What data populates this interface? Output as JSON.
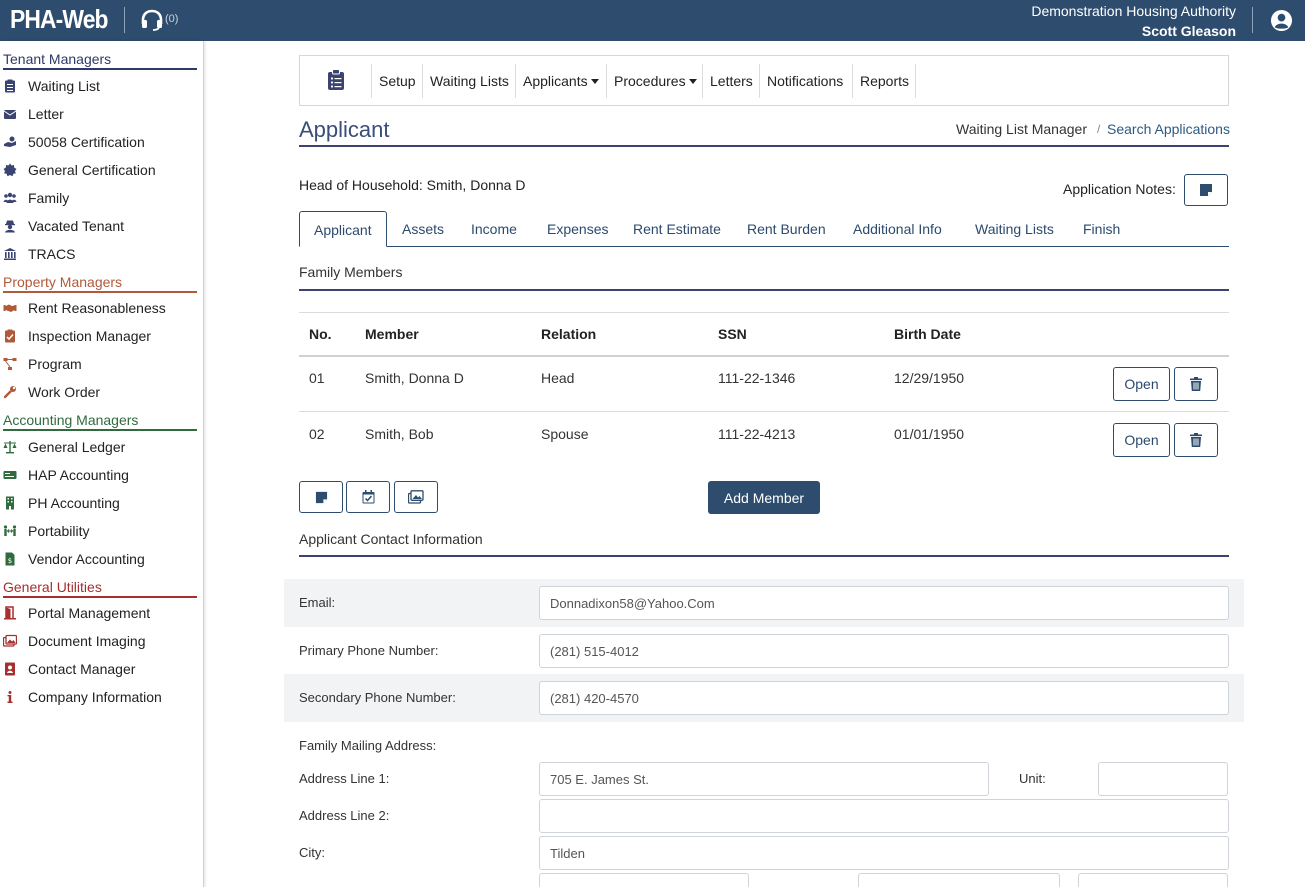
{
  "header": {
    "brand": "PHA-Web",
    "support_count": "(0)",
    "organization": "Demonstration Housing Authority",
    "user": "Scott Gleason"
  },
  "sidebar": {
    "sections": [
      {
        "title": "Tenant Managers",
        "color": "#2e3a66",
        "items": [
          "Waiting List",
          "Letter",
          "50058 Certification",
          "General Certification",
          "Family",
          "Vacated Tenant",
          "TRACS"
        ]
      },
      {
        "title": "Property Managers",
        "color": "#b05a3a",
        "items": [
          "Rent Reasonableness",
          "Inspection Manager",
          "Program",
          "Work Order"
        ]
      },
      {
        "title": "Accounting Managers",
        "color": "#2f6b3d",
        "items": [
          "General Ledger",
          "HAP Accounting",
          "PH Accounting",
          "Portability",
          "Vendor Accounting"
        ]
      },
      {
        "title": "General Utilities",
        "color": "#a62f2f",
        "items": [
          "Portal Management",
          "Document Imaging",
          "Contact Manager",
          "Company Information"
        ]
      }
    ]
  },
  "nav": {
    "items": [
      "Setup",
      "Waiting Lists",
      "Applicants",
      "Procedures",
      "Letters",
      "Notifications",
      "Reports"
    ]
  },
  "page": {
    "title": "Applicant",
    "breadcrumb": [
      "Waiting List Manager",
      "/",
      "Search Applications"
    ],
    "head_of_household": "Head of Household: Smith, Donna D",
    "notes_label": "Application Notes:"
  },
  "tabs": [
    "Applicant",
    "Assets",
    "Income",
    "Expenses",
    "Rent Estimate",
    "Rent Burden",
    "Additional Info",
    "Waiting Lists",
    "Finish"
  ],
  "family": {
    "heading": "Family Members",
    "columns": [
      "No.",
      "Member",
      "Relation",
      "SSN",
      "Birth Date"
    ],
    "rows": [
      {
        "no": "01",
        "member": "Smith, Donna D",
        "relation": "Head",
        "ssn": "111-22-1346",
        "birth": "12/29/1950",
        "open": "Open"
      },
      {
        "no": "02",
        "member": "Smith, Bob",
        "relation": "Spouse",
        "ssn": "111-22-4213",
        "birth": "01/01/1950",
        "open": "Open"
      }
    ],
    "add_member": "Add Member"
  },
  "contact": {
    "heading": "Applicant Contact Information",
    "email_label": "Email:",
    "email": "Donnadixon58@Yahoo.Com",
    "primary_label": "Primary Phone Number:",
    "primary": "(281) 515-4012",
    "secondary_label": "Secondary Phone Number:",
    "secondary": "(281) 420-4570",
    "mailing_label": "Family Mailing Address:",
    "addr1_label": "Address Line 1:",
    "addr1": "705 E. James St.",
    "unit_label": "Unit:",
    "unit": "",
    "addr2_label": "Address Line 2:",
    "addr2": "",
    "city_label": "City:",
    "city": "Tilden"
  },
  "colors": {
    "header_bg": "#2e4d6e",
    "title": "#3b4d78",
    "accent": "#2e4d6e"
  }
}
